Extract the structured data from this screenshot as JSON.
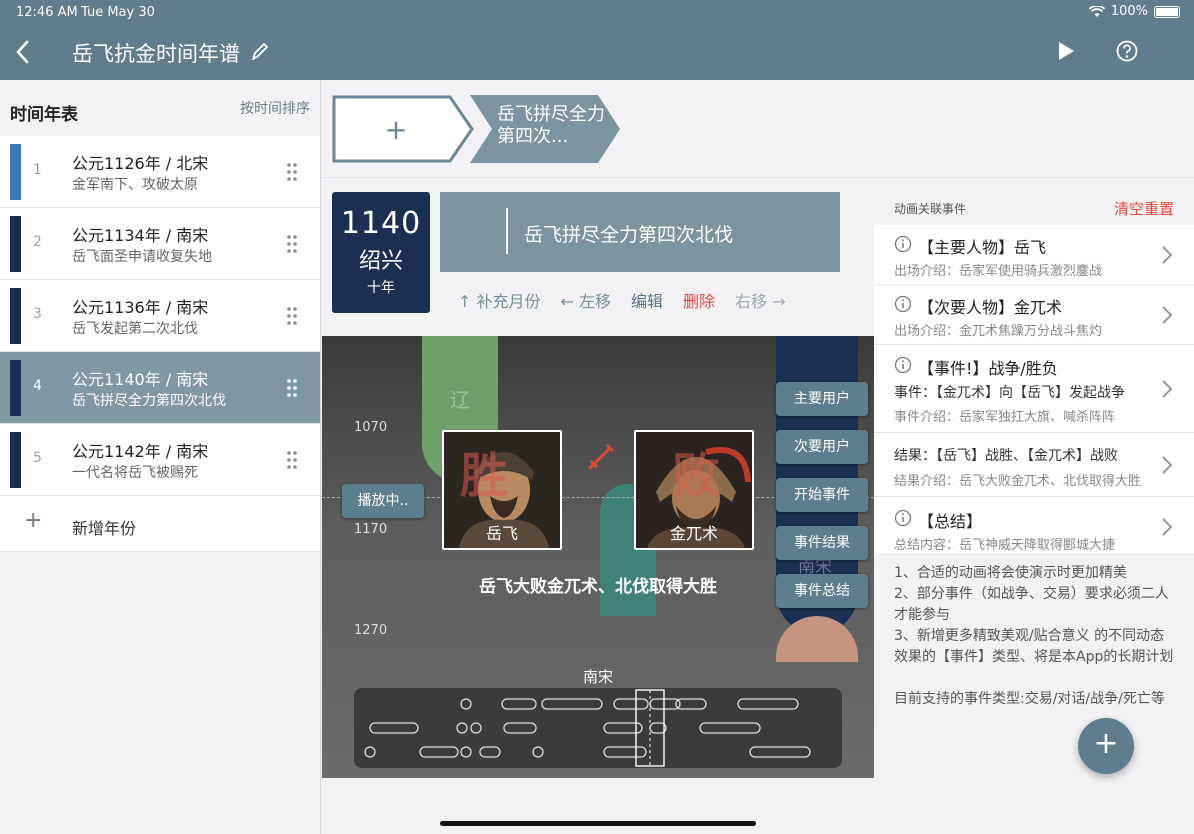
{
  "status": {
    "time": "12:46 AM",
    "date": "Tue May 30",
    "battery": "100%"
  },
  "nav": {
    "title": "岳飞抗金时间年谱"
  },
  "sidebar": {
    "title": "时间年表",
    "sort_label": "按时间排序",
    "items": [
      {
        "num": "1",
        "title": "公元1126年 / 北宋",
        "sub": "金军南下、攻破太原",
        "color": "#3e7ab8"
      },
      {
        "num": "2",
        "title": "公元1134年 / 南宋",
        "sub": "岳飞面圣申请收复失地",
        "color": "#1b2f52"
      },
      {
        "num": "3",
        "title": "公元1136年 / 南宋",
        "sub": "岳飞发起第二次北伐",
        "color": "#1b2f52"
      },
      {
        "num": "4",
        "title": "公元1140年 / 南宋",
        "sub": "岳飞拼尽全力第四次北伐",
        "color": "#1b2f52"
      },
      {
        "num": "5",
        "title": "公元1142年 / 南宋",
        "sub": "一代名将岳飞被赐死",
        "color": "#1b2f52"
      }
    ],
    "selected_index": 3,
    "add_label": "新增年份"
  },
  "crumbs": {
    "add": "+",
    "event": "岳飞拼尽全力第四次..."
  },
  "year_card": {
    "year": "1140",
    "era": "绍兴",
    "sub": "十年"
  },
  "event": {
    "title": "岳飞拼尽全力第四次北伐"
  },
  "actions": {
    "add_month": "↑ 补充月份",
    "left": "← 左移",
    "edit": "编辑",
    "delete": "删除",
    "right": "右移 →"
  },
  "preview": {
    "ticks": [
      "1070",
      "1170",
      "1270"
    ],
    "playing": "播放中..",
    "buttons": [
      "主要用户",
      "次要用户",
      "开始事件",
      "事件结果",
      "事件总结"
    ],
    "hero_left": "岳飞",
    "hero_right": "金兀术",
    "big_left": "胜",
    "big_right": "败",
    "tag_liao": "辽",
    "tag_nan": "南宋",
    "caption": "岳飞大败金兀术、北伐取得大胜",
    "dynasty": "南宋"
  },
  "right_panel": {
    "title": "动画关联事件",
    "clear": "清空重置",
    "items": [
      {
        "t1": "【主要人物】岳飞",
        "t2": "出场介绍：岳家军使用骑兵激烈鏖战"
      },
      {
        "t1": "【次要人物】金兀术",
        "t2": "出场介绍：金兀术焦躁万分战斗焦灼"
      },
      {
        "t1": "【事件!】战争/胜负",
        "t2a": "事件：【金兀术】向【岳飞】发起战争",
        "t2": "事件介绍：岳家军独扛大旗、喊杀阵阵"
      },
      {
        "t1": "结果：【岳飞】战胜、【金兀术】战败",
        "t2": "结果介绍：岳飞大败金兀术、北伐取得大胜"
      },
      {
        "t1": "【总结】",
        "t2": "总结内容：岳飞神威天降取得郾城大捷"
      }
    ],
    "notes": [
      "1、合适的动画将会使演示时更加精美",
      "2、部分事件（如战争、交易）要求必须二人才能参与",
      "3、新增更多精致美观/贴合意义 的不同动态效果的【事件】类型、将是本App的长期计划",
      "",
      "目前支持的事件类型:交易/对话/战争/死亡等"
    ]
  },
  "fab": "+"
}
